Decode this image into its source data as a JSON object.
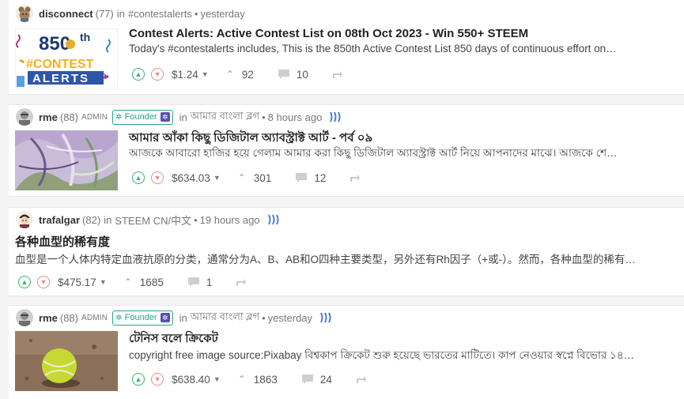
{
  "posts": [
    {
      "author": "disconnect",
      "reputation": "(77)",
      "community_prefix": "in",
      "community": "#contestalerts",
      "time": "yesterday",
      "title": "Contest Alerts: Active Contest List on 08th Oct 2023 - Win 550+ STEEM",
      "excerpt": "Today's #contestalerts includes, This is the 850th Active Contest List 850 days of continuous effort on…",
      "payout": "$1.24",
      "votes": "92",
      "comments": "10",
      "thumb_text": {
        "line1": "850",
        "sup": "th",
        "line2": "#CONTEST",
        "line3": "ALERTS"
      }
    },
    {
      "author": "rme",
      "reputation": "(88)",
      "role": "ADMIN",
      "badge": "Founder",
      "community_prefix": "in",
      "community": "আমার বাংলা ব্লগ",
      "time": "8 hours ago",
      "title": "আমার আঁকা কিছু ডিজিটাল অ্যাবস্ট্রাক্ট আর্ট - পর্ব ০৯",
      "excerpt": "আজকে আবারো হাজির হয়ে গেলাম আমার করা কিছু ডিজিটাল অ্যাবস্ট্রাক্ট আর্ট নিয়ে আপনাদের মাঝে। আজকে শে…",
      "payout": "$634.03",
      "votes": "301",
      "comments": "12"
    },
    {
      "author": "trafalgar",
      "reputation": "(82)",
      "community_prefix": "in",
      "community": "STEEM CN/中文",
      "time": "19 hours ago",
      "title": "各种血型的稀有度",
      "excerpt": "血型是一个人体内特定血液抗原的分类，通常分为A、B、AB和O四种主要类型，另外还有Rh因子（+或-）。然而，各种血型的稀有…",
      "payout": "$475.17",
      "votes": "1685",
      "comments": "1"
    },
    {
      "author": "rme",
      "reputation": "(88)",
      "role": "ADMIN",
      "badge": "Founder",
      "community_prefix": "in",
      "community": "আমার বাংলা ব্লগ",
      "time": "yesterday",
      "title": "টেনিস বলে ক্রিকেট",
      "excerpt": "copyright free image source:Pixabay বিশ্বকাপ ক্রিকেট শুরু হয়েছে ভারতের মাটিতে। কাপ নেওয়ার স্বপ্নে বিভোর ১৪…",
      "payout": "$638.40",
      "votes": "1863",
      "comments": "24"
    }
  ],
  "colors": {
    "upvote": "#3cb371",
    "downvote": "#e88b8b",
    "founder_badge": "#2aa18a",
    "steem_icon": "#4b7bd8"
  },
  "icons": {
    "upvote": "chevron-up-icon",
    "downvote": "chevron-down-icon",
    "votes": "caret-up-icon",
    "comments": "comment-icon",
    "reblog": "reblog-icon",
    "steem": "steem-logo-icon"
  }
}
